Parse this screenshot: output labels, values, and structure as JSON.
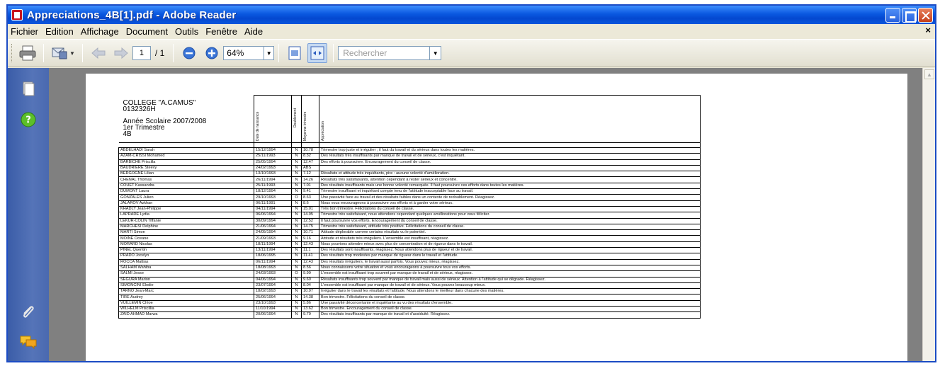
{
  "window": {
    "title": "Appreciations_4B[1].pdf - Adobe Reader"
  },
  "menu": [
    "Fichier",
    "Edition",
    "Affichage",
    "Document",
    "Outils",
    "Fenêtre",
    "Aide"
  ],
  "toolbar": {
    "page_current": "1",
    "page_total": "/ 1",
    "zoom": "64%",
    "search_placeholder": "Rechercher"
  },
  "document": {
    "school_lines": [
      "COLLEGE \"A.CAMUS\"",
      "0132326H",
      "",
      "Année Scolaire 2007/2008",
      "1er Trimestre",
      "4B"
    ],
    "headers": [
      "Date de naissance",
      "Doublement",
      "Moyenne trimestre",
      "Appréciation"
    ],
    "rows": [
      [
        "ABDELHADI Sarah",
        "15/12/1994",
        "N",
        "10.78",
        "Trimestre trop juste et irrégulier ; il faut du travail et du sérieux dans toutes les matières."
      ],
      [
        "AZAM-CRISSI Mohamed",
        "25/11/1993",
        "N",
        "8.32",
        "Des résultats très insuffisants par manque de travail et de sérieux, c'est inquiétant."
      ],
      [
        "BARBICHE Priscilla",
        "25/05/1994",
        "N",
        "12.47",
        "Des efforts à poursuivre. Encouragement du conseil de classe."
      ],
      [
        "BAUDRIERE Steevy",
        "24/02/1993",
        "N",
        "ABS",
        ""
      ],
      [
        "BERGOGNE Lilian",
        "13/10/1993",
        "N",
        "7.12",
        "Résultats et attitude très inquiétants, pire : aucune volonté d'amélioration."
      ],
      [
        "CHENAL Thomas",
        "26/11/1994",
        "N",
        "14.26",
        "Résultats très satisfaisants, attention cependant à rester sérieux et concentré."
      ],
      [
        "COUET Kassandra",
        "25/11/1993",
        "N",
        "7.01",
        "Des résultats insuffisants mais une bonne volonté remarquée. Il faut poursuivre ces efforts dans toutes les matières."
      ],
      [
        "DUMONT Laura",
        "18/12/1994",
        "N",
        "9.41",
        "Trimestre insuffisant et inquiétant compte tenu de l'attitude inacceptable face au travail."
      ],
      [
        "GONZALES Julien",
        "29/10/1993",
        "O",
        "8.63",
        "Une passivité face au travail et des résultats faibles dans un contexte de redoublement. Réagissez."
      ],
      [
        "JALAROV Azkhan",
        "06/11/1991",
        "N",
        "8.6",
        "Nous vous encourageons à poursuivre vos efforts et à garder votre sérieux."
      ],
      [
        "KHADLY Jean-Philippe",
        "04/11/1994",
        "N",
        "15.01",
        "Très bon trimestre. Félicitations du conseil de classe."
      ],
      [
        "LAPRADE Lydia",
        "06/06/1994",
        "N",
        "14.05",
        "Trimestre très satisfaisant, nous attendons cependant quelques améliorations pour vous féliciter."
      ],
      [
        "LEKUR-COLIN Tiffanie",
        "30/09/1994",
        "N",
        "12.52",
        "Il faut poursuivre vos efforts. Encouragement du conseil de classe."
      ],
      [
        "MARCHESI Delphine",
        "21/06/1994",
        "N",
        "14.75",
        "Trimestre très satisfaisant, attitude très positive. Félicitations du conseil de classe."
      ],
      [
        "MARTI Simon",
        "24/05/1994",
        "N",
        "10.71",
        "Attitude déplorable comme certains résultats vu le potentiel."
      ],
      [
        "MOINE Oceane",
        "21/09/1993",
        "N",
        "9.16",
        "Attitude et résultats très irréguliers. L'ensemble est insuffisant, réagissez."
      ],
      [
        "MORARD Nicolas",
        "18/11/1994",
        "N",
        "12.43",
        "Nous pouvions attendre mieux avec plus de concentration et de rigueur dans le travail."
      ],
      [
        "PINEL Quentin",
        "13/11/1994",
        "N",
        "11.1",
        "Des résultats sont insuffisants, réagissez. Nous attendons plus de rigueur et de travail."
      ],
      [
        "PRADO Jocelyn",
        "18/06/1995",
        "N",
        "11.41",
        "Des résultats trop modestes par manque de rigueur dans le travail et l'attitude."
      ],
      [
        "ROCCA Mattias",
        "06/11/1994",
        "N",
        "12.43",
        "Des résultats irréguliers, le travail aussi parfois. Vous pouvez mieux, réagissez."
      ],
      [
        "SALHAM Wahiba",
        "18/08/1993",
        "N",
        "8.56",
        "Nous connaissons votre situation et vous encourageons à poursuivre tous vos efforts."
      ],
      [
        "SALMI Jesse",
        "24/03/1993",
        "O",
        "9.99",
        "L'ensemble est insuffisant trop souvent par manque de travail et de sérieux, réagissez."
      ],
      [
        "SEGURA Marion",
        "04/06/1994",
        "N",
        "9.60",
        "Résultats insuffisants trop souvent par manque de travail mais aussi de sérieux. Attention à l'attitude qui se dégrade. Réagissez."
      ],
      [
        "SIMONCINI Elodie",
        "23/07/1994",
        "N",
        "8.04",
        "L'ensemble est insuffisant par manque de travail et de sérieux. Vous pouvez beaucoup mieux."
      ],
      [
        "TARNO Jean-Marc",
        "18/02/1993",
        "N",
        "10.97",
        "Irrégulier dans le travail les résultats et l'attitude. Nous attendons le meilleur dans chacune des matières."
      ],
      [
        "TIRE Audrey",
        "25/06/1994",
        "N",
        "14.38",
        "Bon trimestre. Félicitations du conseil de classe."
      ],
      [
        "VUILLEMIN Chloe",
        "23/10/1993",
        "N",
        "5.86",
        "Une passivité déconcertante et inquiétante au vu des résultats d'ensemble."
      ],
      [
        "WILHELM Priscillia",
        "11/10/1994",
        "N",
        "13.62",
        "Bon trimestre. Encouragement du conseil de classe."
      ],
      [
        "ZAID AHMAD Marwa",
        "20/06/1994",
        "N",
        "9.79",
        "Des résultats insuffisants par manque de travail et d'assiduité. Réagissez."
      ]
    ]
  }
}
